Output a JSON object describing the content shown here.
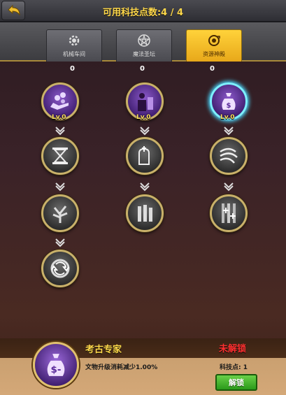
{
  "header": {
    "title_label": "可用科技点数:",
    "points_value": "4 / 4"
  },
  "tabs": [
    {
      "label": "机械车间",
      "icon": "gear-icon",
      "active": false
    },
    {
      "label": "魔法圣坛",
      "icon": "pentagram-icon",
      "active": false
    },
    {
      "label": "资源神殿",
      "icon": "coin-cycle-icon",
      "active": true
    }
  ],
  "column_points": [
    "0",
    "0",
    "0"
  ],
  "tree": {
    "columns": [
      {
        "nodes": [
          {
            "icon": "coins-hand-icon",
            "level": "Lv.0",
            "unlocked": true
          },
          {
            "icon": "hourglass-icon"
          },
          {
            "icon": "tree-spirit-icon"
          },
          {
            "icon": "cycle-arrows-icon"
          }
        ]
      },
      {
        "nodes": [
          {
            "icon": "shadow-figure-icon",
            "level": "Lv.0",
            "unlocked": true
          },
          {
            "icon": "tombstone-icon"
          },
          {
            "icon": "pillars-icon"
          }
        ]
      },
      {
        "nodes": [
          {
            "icon": "money-bag-icon",
            "level": "Lv.0",
            "unlocked": true,
            "selected": true
          },
          {
            "icon": "wind-swirl-icon"
          },
          {
            "icon": "sparkle-rays-icon"
          }
        ]
      }
    ]
  },
  "detail": {
    "icon": "money-bag-icon",
    "name": "考古专家",
    "status": "未解锁",
    "description": "文物升级消耗减少1.00%",
    "points_label": "科技点:",
    "points_value": "1",
    "unlock_label": "解锁"
  },
  "colors": {
    "accent_gold": "#ffd84a",
    "locked_red": "#ff3030",
    "unlock_green": "#2a9a1a",
    "selected_glow": "#4ad8ff"
  }
}
